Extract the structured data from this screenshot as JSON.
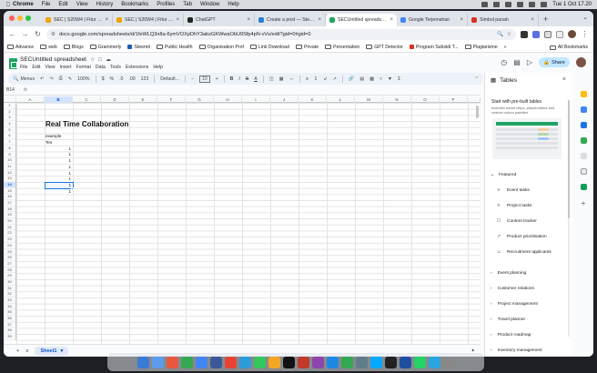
{
  "menubar": {
    "apple": "",
    "items": [
      "Chrome",
      "File",
      "Edit",
      "View",
      "History",
      "Bookmarks",
      "Profiles",
      "Tab",
      "Window",
      "Help"
    ],
    "clock": "Tue 1 Oct  17.20"
  },
  "browser": {
    "tabs": [
      {
        "label": "SEC | S20W4 | Fitur da...",
        "color": "#f0a500"
      },
      {
        "label": "SEC | S20W4 | Fitur da...",
        "color": "#f0a500"
      },
      {
        "label": "ChatGPT",
        "color": "#222222"
      },
      {
        "label": "Create a post — Steem...",
        "color": "#2a7fd4"
      },
      {
        "label": "SECUntitled spreadsh...",
        "color": "#1fa463",
        "active": true
      },
      {
        "label": "Google Terjemahan",
        "color": "#4285f4"
      },
      {
        "label": "Simbol panah",
        "color": "#d93025"
      }
    ],
    "new_tab": "+",
    "url": "docs.google.com/spreadsheets/d/1feWLQ3n8a-6ymVOXpDhY3abzGKWwaObU9Sfp4pN-vVs/edit?gid=0#gid=0",
    "bookmarks": [
      {
        "label": "Advance",
        "type": "folder"
      },
      {
        "label": "web",
        "type": "folder"
      },
      {
        "label": "Blogs",
        "type": "folder"
      },
      {
        "label": "Grammerly",
        "type": "folder"
      },
      {
        "label": "Steemit",
        "type": "fav",
        "color": "#1a5fb4"
      },
      {
        "label": "Public Health",
        "type": "folder"
      },
      {
        "label": "Organisation Prof",
        "type": "folder"
      },
      {
        "label": "Link Download",
        "type": "folder"
      },
      {
        "label": "Private",
        "type": "folder"
      },
      {
        "label": "Persentation",
        "type": "folder"
      },
      {
        "label": "GPT Detector",
        "type": "folder"
      },
      {
        "label": "Program Subsidi T...",
        "type": "fav",
        "color": "#d93025"
      },
      {
        "label": "Plagiarisme",
        "type": "folder"
      }
    ],
    "more_bookmarks": "»",
    "all_bookmarks": "All Bookmarks"
  },
  "sheets": {
    "title": "SECUntitled spreadsheet",
    "menu": [
      "File",
      "Edit",
      "View",
      "Insert",
      "Format",
      "Data",
      "Tools",
      "Extensions",
      "Help"
    ],
    "share_label": "Share",
    "toolbar": {
      "search": "Menus",
      "zoom": "100%",
      "currency": "$",
      "percent": "%",
      "dec_minus": ".0",
      "dec_plus": ".00",
      "number_format": "123",
      "font": "Default...",
      "font_size": "10"
    },
    "name_box": "B14",
    "fx": "fx",
    "columns": [
      "A",
      "B",
      "C",
      "D",
      "E",
      "F",
      "G",
      "H",
      "I",
      "J",
      "K",
      "L",
      "M",
      "N",
      "O",
      "P",
      "Q"
    ],
    "rows": [
      "1",
      "2",
      "3",
      "4",
      "5",
      "6",
      "7",
      "8",
      "9",
      "10",
      "11",
      "12",
      "13",
      "14",
      "15",
      "16",
      "17",
      "18",
      "19",
      "20",
      "21",
      "22",
      "23",
      "24",
      "25",
      "26",
      "27",
      "28",
      "29",
      "30",
      "31",
      "32",
      "33",
      "34",
      "35",
      "36",
      "37",
      "38",
      "39"
    ],
    "selected_cell": "B14",
    "cells": {
      "heading": "Real Time Collaboration",
      "example": "example",
      "tes": "Tes",
      "numbers": [
        "1",
        "1",
        "1",
        "1",
        "1",
        "1",
        "1",
        "1"
      ]
    },
    "sheet_tab": "Sheet1",
    "add_sheet": "+",
    "all_sheets": "≡"
  },
  "panel": {
    "title": "Tables",
    "intro_title": "Start with pre-built tables",
    "intro_sub": "Includes smart chips, placeholders and custom colour palettes",
    "featured_label": "Featured",
    "featured": [
      "Event tasks",
      "Project tasks",
      "Content tracker",
      "Product prioritisation",
      "Recruitment applicants"
    ],
    "categories": [
      "Event planning",
      "Customer relations",
      "Project management",
      "Travel planner",
      "Product roadmap",
      "Inventory management"
    ]
  },
  "dock_colors": [
    "#3a7bd5",
    "#5d9cec",
    "#e9573f",
    "#34a853",
    "#4285f4",
    "#3b5998",
    "#ea4335",
    "#2d9cdb",
    "#34c759",
    "#f5a623",
    "#111111",
    "#c0392b",
    "#8e44ad",
    "#1e88e5",
    "#34a853",
    "#607d8b",
    "#00aaff",
    "#222222",
    "#1c4fa0",
    "#25d366",
    "#2aa5e0",
    "#888888"
  ]
}
